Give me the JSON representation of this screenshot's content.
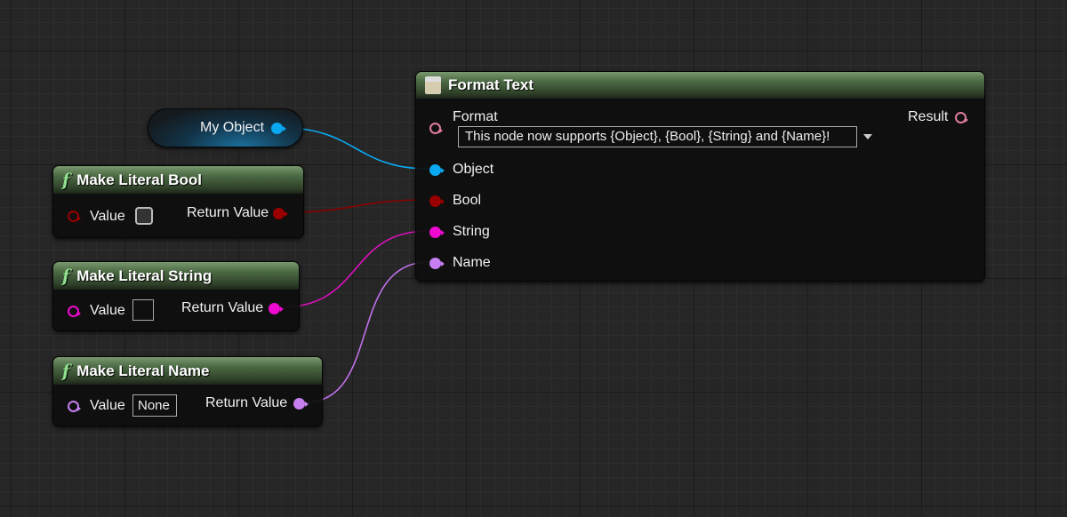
{
  "colors": {
    "object": "#0aa8f0",
    "bool": "#9a0000",
    "string": "#f00ad0",
    "name": "#c67ef0",
    "text": "#e07c9c"
  },
  "variable_node": {
    "label": "My Object"
  },
  "bool_node": {
    "title": "Make Literal Bool",
    "icon": "function-icon",
    "value_label": "Value",
    "value_checked": false,
    "return_label": "Return Value"
  },
  "string_node": {
    "title": "Make Literal String",
    "icon": "function-icon",
    "value_label": "Value",
    "value": "",
    "return_label": "Return Value"
  },
  "name_node": {
    "title": "Make Literal Name",
    "icon": "function-icon",
    "value_label": "Value",
    "value": "None",
    "return_label": "Return Value"
  },
  "format_node": {
    "title": "Format Text",
    "icon": "text-format-icon",
    "format_label": "Format",
    "format_value": "This node now supports {Object}, {Bool}, {String} and {Name}!",
    "result_label": "Result",
    "inputs": [
      "Object",
      "Bool",
      "String",
      "Name"
    ]
  }
}
